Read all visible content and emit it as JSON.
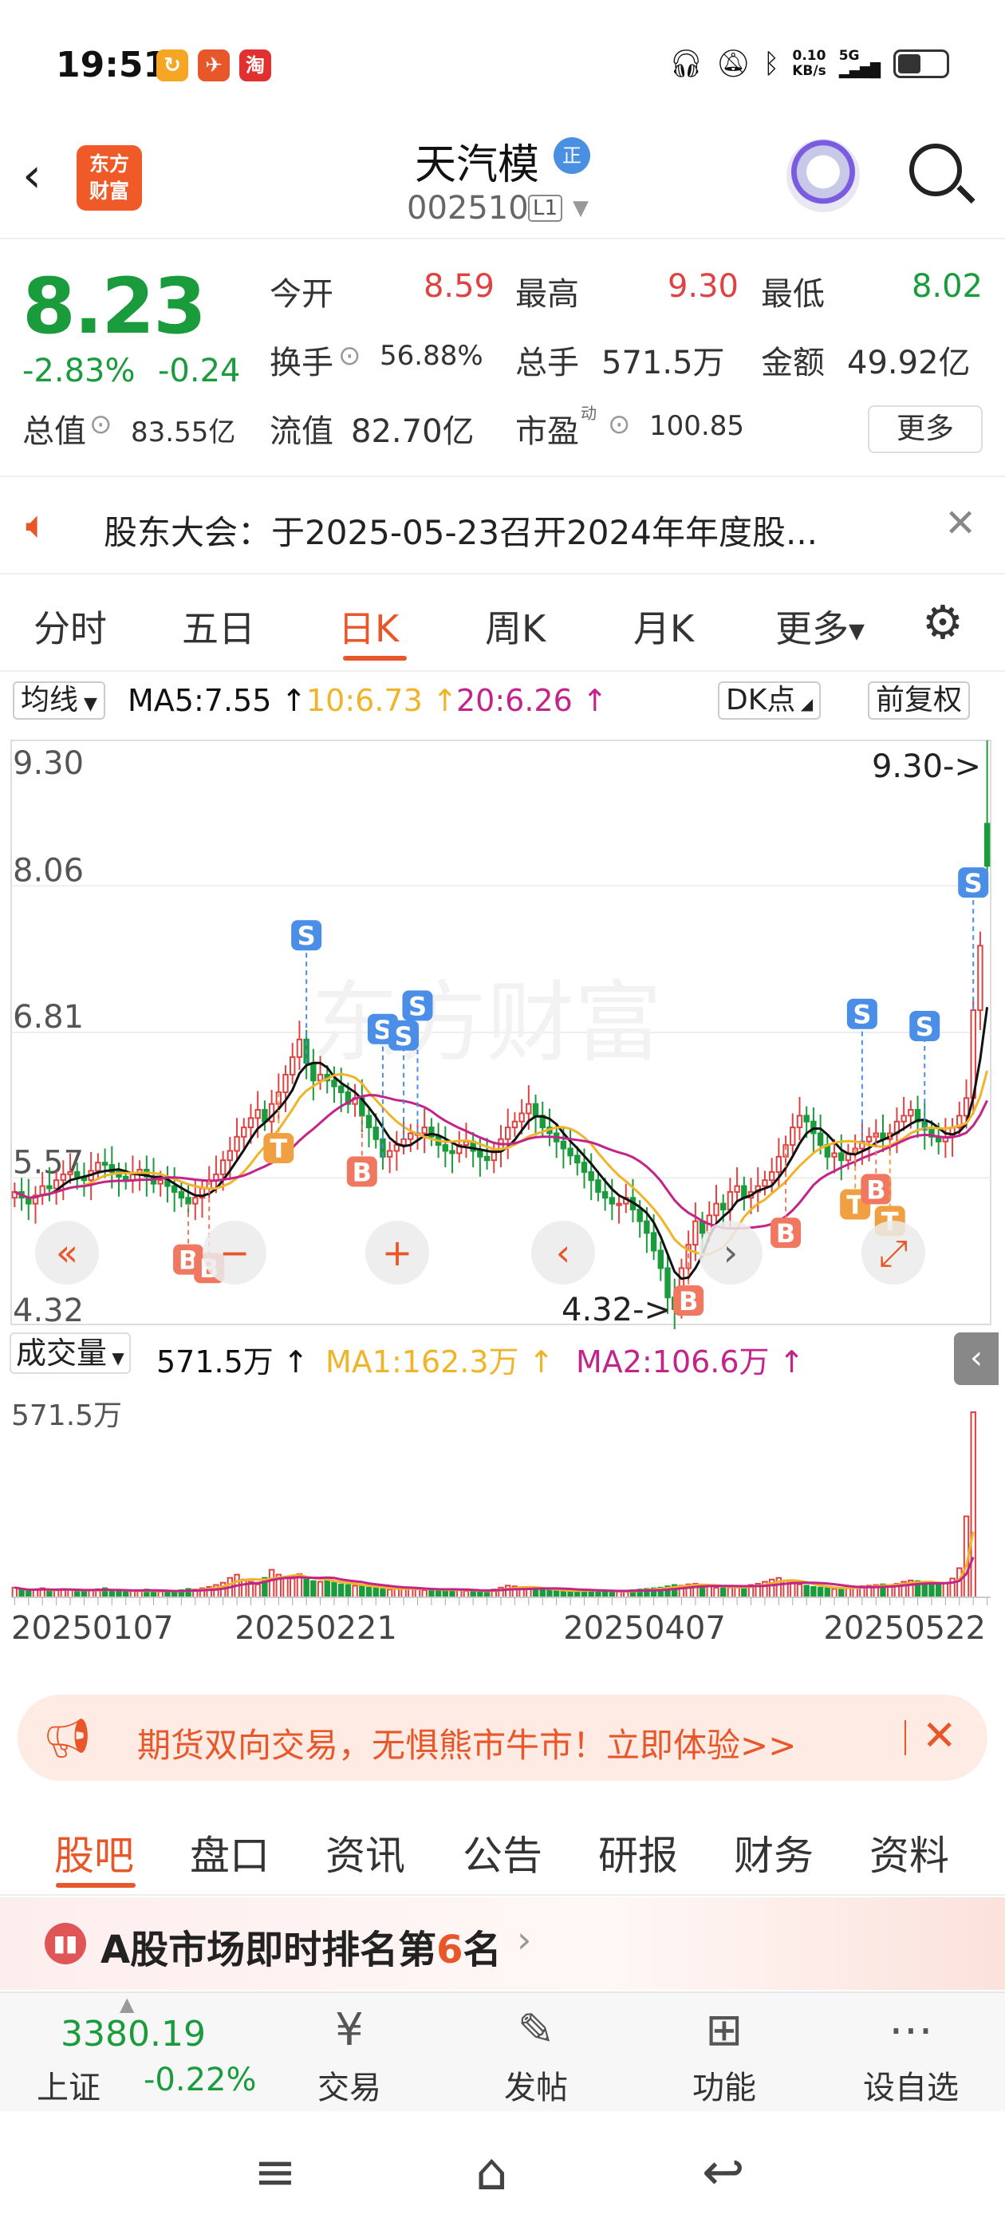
{
  "status_bar": {
    "time": "19:51",
    "apps": [
      "↻",
      "✈",
      "淘"
    ],
    "net_speed_value": "0.10",
    "net_speed_unit": "KB/s",
    "signal": "5G"
  },
  "header": {
    "stock_name": "天汽模",
    "verified_badge": "正",
    "stock_code": "002510",
    "level_badge": "L1",
    "logo_line1": "东方",
    "logo_line2": "财富"
  },
  "quote": {
    "price": "8.23",
    "change_pct": "-2.83%",
    "change_abs": "-0.24",
    "open_label": "今开",
    "open_value": "8.59",
    "high_label": "最高",
    "high_value": "9.30",
    "low_label": "最低",
    "low_value": "8.02",
    "turnover_label": "换手",
    "turnover_value": "56.88%",
    "volume_label": "总手",
    "volume_value": "571.5万",
    "amount_label": "金额",
    "amount_value": "49.92亿",
    "total_cap_label": "总值",
    "total_cap_value": "83.55亿",
    "float_cap_label": "流值",
    "float_cap_value": "82.70亿",
    "pe_label": "市盈",
    "pe_sup": "动",
    "pe_value": "100.85",
    "more_button": "更多"
  },
  "notice": {
    "text": "股东大会：于2025-05-23召开2024年年度股..."
  },
  "chart_tabs": [
    "分时",
    "五日",
    "日K",
    "周K",
    "月K",
    "更多"
  ],
  "ma_legend": {
    "selector": "均线",
    "ma5": "MA5:7.55",
    "ma10": "10:6.73",
    "ma20": "20:6.26",
    "dk_points": "DK点",
    "adjust": "前复权"
  },
  "volume_legend": {
    "selector": "成交量",
    "value": "571.5万",
    "ma1": "MA1:162.3万",
    "ma2": "MA2:106.6万"
  },
  "colors": {
    "up": "#e04141",
    "down": "#1a9b3c",
    "accent": "#e8572a",
    "ma5": "#111111",
    "ma10": "#f0b429",
    "ma20": "#c2248a",
    "signal_buy": "#f07860",
    "signal_sell": "#4a8ee8",
    "signal_t": "#f0a040"
  },
  "chart_data": {
    "type": "candlestick",
    "price_axis_labels": [
      "9.30",
      "8.06",
      "6.81",
      "5.57",
      "4.32"
    ],
    "ylim": [
      4.32,
      9.3
    ],
    "max_annotation": "9.30->",
    "min_annotation": "4.32->",
    "date_labels": [
      "20250107",
      "20250221",
      "20250407",
      "20250522"
    ],
    "volume_axis_label": "571.5万",
    "signal_letters": {
      "buy": "B",
      "sell": "S",
      "t": "T"
    },
    "signals": [
      {
        "type": "B",
        "i": 25
      },
      {
        "type": "B",
        "i": 28
      },
      {
        "type": "T",
        "i": 38
      },
      {
        "type": "S",
        "i": 42
      },
      {
        "type": "B",
        "i": 50
      },
      {
        "type": "S",
        "i": 53
      },
      {
        "type": "S",
        "i": 56
      },
      {
        "type": "S",
        "i": 58
      },
      {
        "type": "B",
        "i": 97
      },
      {
        "type": "B",
        "i": 111
      },
      {
        "type": "T",
        "i": 121
      },
      {
        "type": "S",
        "i": 122
      },
      {
        "type": "B",
        "i": 124
      },
      {
        "type": "T",
        "i": 126
      },
      {
        "type": "S",
        "i": 131
      },
      {
        "type": "S",
        "i": 138
      }
    ],
    "closes": [
      5.45,
      5.4,
      5.35,
      5.42,
      5.5,
      5.48,
      5.55,
      5.6,
      5.62,
      5.58,
      5.55,
      5.63,
      5.7,
      5.68,
      5.62,
      5.58,
      5.55,
      5.6,
      5.64,
      5.58,
      5.52,
      5.55,
      5.5,
      5.45,
      5.4,
      5.35,
      5.4,
      5.48,
      5.55,
      5.6,
      5.72,
      5.8,
      5.92,
      6.0,
      6.08,
      6.15,
      6.05,
      6.2,
      6.3,
      6.45,
      6.6,
      6.75,
      6.55,
      6.4,
      6.45,
      6.4,
      6.35,
      6.3,
      6.2,
      6.25,
      6.1,
      6.0,
      5.9,
      5.75,
      5.8,
      5.85,
      5.9,
      5.95,
      5.95,
      6.0,
      5.92,
      5.85,
      5.8,
      5.78,
      5.85,
      5.88,
      5.8,
      5.75,
      5.72,
      5.8,
      5.9,
      6.0,
      6.05,
      6.12,
      6.2,
      6.1,
      6.0,
      5.95,
      5.88,
      5.82,
      5.76,
      5.7,
      5.62,
      5.55,
      5.45,
      5.4,
      5.35,
      5.35,
      5.4,
      5.3,
      5.2,
      5.1,
      4.95,
      4.8,
      4.55,
      4.45,
      4.8,
      5.0,
      5.2,
      5.1,
      5.25,
      5.35,
      5.3,
      5.45,
      5.5,
      5.4,
      5.45,
      5.5,
      5.55,
      5.62,
      5.75,
      5.85,
      6.0,
      6.1,
      6.05,
      5.95,
      5.85,
      5.75,
      5.78,
      5.72,
      5.78,
      5.82,
      5.88,
      5.92,
      5.95,
      5.9,
      5.95,
      6.05,
      6.1,
      6.15,
      6.05,
      5.98,
      5.92,
      5.88,
      5.92,
      6.0,
      6.1,
      6.25,
      7.0,
      7.55,
      8.23
    ],
    "volumes": [
      30,
      22,
      18,
      25,
      28,
      20,
      22,
      26,
      24,
      20,
      18,
      22,
      25,
      28,
      22,
      18,
      16,
      20,
      22,
      24,
      20,
      18,
      16,
      18,
      22,
      26,
      24,
      28,
      32,
      38,
      45,
      60,
      70,
      55,
      48,
      40,
      60,
      85,
      70,
      62,
      58,
      72,
      55,
      50,
      48,
      52,
      45,
      40,
      38,
      36,
      34,
      30,
      28,
      25,
      24,
      26,
      28,
      30,
      25,
      22,
      20,
      22,
      24,
      26,
      22,
      20,
      18,
      18,
      20,
      24,
      30,
      36,
      34,
      30,
      28,
      26,
      24,
      22,
      20,
      18,
      20,
      22,
      24,
      22,
      20,
      18,
      16,
      18,
      20,
      22,
      24,
      26,
      28,
      30,
      34,
      38,
      36,
      40,
      42,
      38,
      34,
      30,
      28,
      30,
      32,
      34,
      38,
      42,
      48,
      55,
      60,
      52,
      46,
      40,
      36,
      32,
      30,
      28,
      26,
      28,
      30,
      32,
      34,
      36,
      38,
      40,
      38,
      42,
      48,
      52,
      50,
      46,
      40,
      38,
      44,
      58,
      90,
      250,
      571.5
    ]
  },
  "ad": {
    "text": "期货双向交易，无惧熊市牛市！立即体验>>"
  },
  "info_tabs": [
    "股吧",
    "盘口",
    "资讯",
    "公告",
    "研报",
    "财务",
    "资料"
  ],
  "ranking": {
    "prefix": "A股市场即时排名第",
    "number": "6",
    "suffix": "名"
  },
  "bottom_bar": {
    "index_value": "3380.19",
    "index_name": "上证",
    "index_change": "-0.22%",
    "items": [
      {
        "label": "交易",
        "icon": "¥"
      },
      {
        "label": "发帖",
        "icon": "✎"
      },
      {
        "label": "功能",
        "icon": "⊞"
      },
      {
        "label": "设自选",
        "icon": "⋯"
      }
    ]
  }
}
